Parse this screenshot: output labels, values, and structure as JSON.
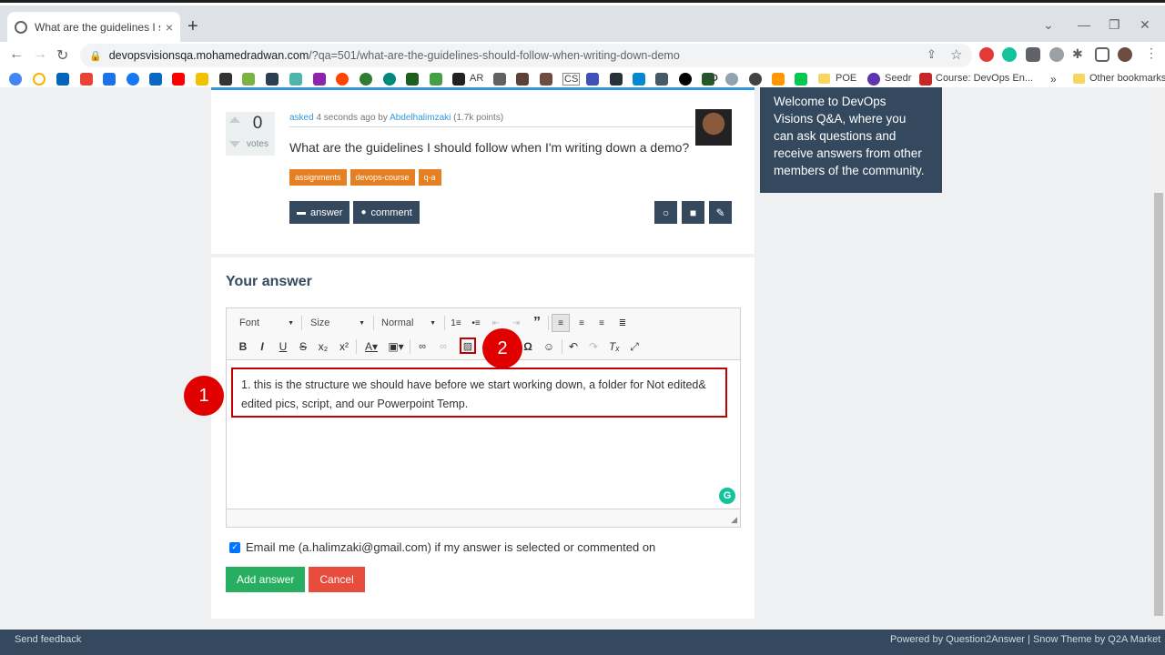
{
  "browser": {
    "tab_title": "What are the guidelines I should",
    "tab_close": "×",
    "new_tab": "+",
    "url_host": "devopsvisionsqa.mohamedradwan.com",
    "url_path": "/?qa=501/what-are-the-guidelines-should-follow-when-writing-down-demo",
    "window_controls": [
      "⌄",
      "—",
      "❐",
      "✕"
    ],
    "bookmarks": [
      {
        "label": "AR"
      },
      {
        "label": "CS"
      },
      {
        "label": "HD"
      },
      {
        "label": "POE"
      },
      {
        "label": "Seedr"
      },
      {
        "label": "Course: DevOps En..."
      }
    ],
    "more": "»",
    "other_bookmarks": "Other bookmarks"
  },
  "question": {
    "votes": "0",
    "votes_label": "votes",
    "meta_asked": "asked",
    "meta_when": " 4 seconds ago by ",
    "meta_author": "Abdelhalimzaki",
    "meta_points": " (1.7k points)",
    "title": "What are the guidelines I should follow when I'm writing down a demo?",
    "tags": [
      "assignments",
      "devops-course",
      "q-a"
    ],
    "answer_button": "answer",
    "comment_button": "comment"
  },
  "sidebar": {
    "welcome": "Welcome to DevOps Visions Q&A, where you can ask questions and receive answers from other members of the community."
  },
  "answer": {
    "heading": "Your answer",
    "editor": {
      "font_label": "Font",
      "size_label": "Size",
      "format_label": "Normal",
      "content": "1. this is the structure we should have before we start working down, a folder for Not edited& edited pics, script, and our Powerpoint Temp."
    },
    "email_notify": "Email me (a.halimzaki@gmail.com) if my answer is selected or commented on",
    "add_button": "Add answer",
    "cancel_button": "Cancel"
  },
  "annotations": {
    "marker_1": "1",
    "marker_2": "2",
    "accent_color": "#e00000"
  },
  "footer": {
    "left": "Send feedback",
    "right": "Powered by Question2Answer  |  Snow Theme by Q2A Market"
  }
}
